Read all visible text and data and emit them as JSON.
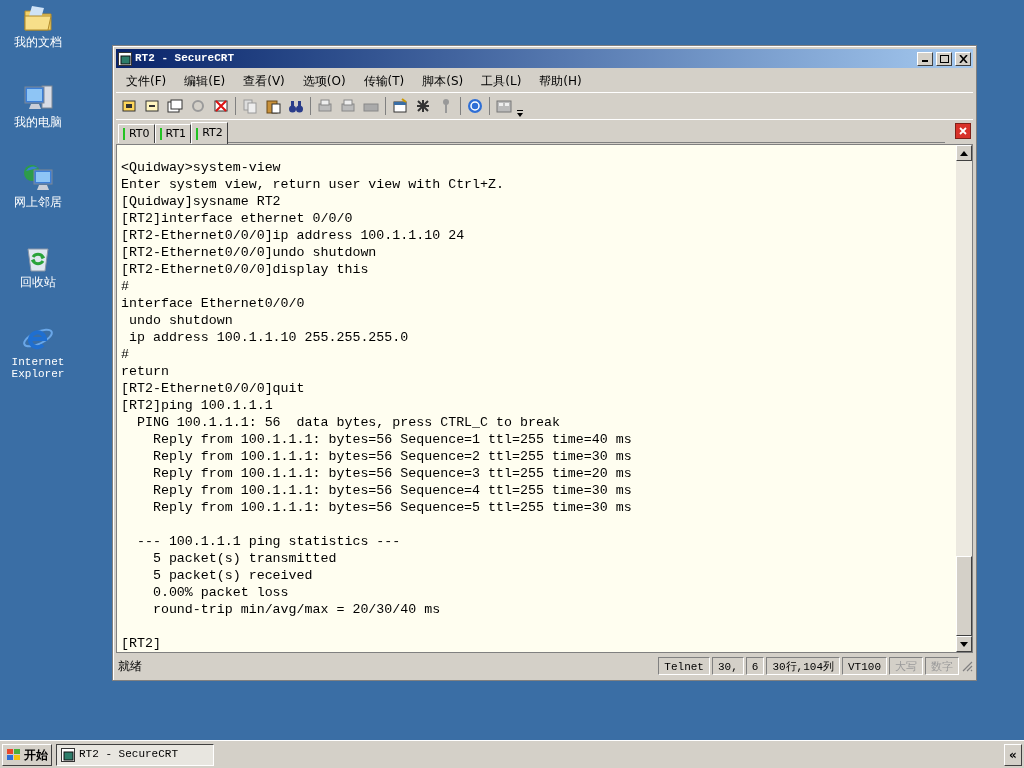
{
  "desktop_icons": [
    {
      "label": "我的文档",
      "kind": "folder"
    },
    {
      "label": "我的电脑",
      "kind": "computer"
    },
    {
      "label": "网上邻居",
      "kind": "network"
    },
    {
      "label": "回收站",
      "kind": "recycle"
    },
    {
      "label": "Internet Explorer",
      "kind": "browser"
    }
  ],
  "window": {
    "title": "RT2 - SecureCRT"
  },
  "menu": [
    "文件(F)",
    "编辑(E)",
    "查看(V)",
    "选项(O)",
    "传输(T)",
    "脚本(S)",
    "工具(L)",
    "帮助(H)"
  ],
  "tabs": [
    {
      "label": "RT0",
      "selected": false
    },
    {
      "label": "RT1",
      "selected": false
    },
    {
      "label": "RT2",
      "selected": true
    }
  ],
  "terminal": {
    "blocks": [
      [
        "<Quidway>system-view",
        "Enter system view, return user view with Ctrl+Z.",
        "[Quidway]sysname RT2",
        "[RT2]interface ethernet 0/0/0",
        "[RT2-Ethernet0/0/0]ip address 100.1.1.10 24",
        "[RT2-Ethernet0/0/0]undo shutdown",
        "[RT2-Ethernet0/0/0]display this",
        "#",
        "interface Ethernet0/0/0",
        " undo shutdown",
        " ip address 100.1.1.10 255.255.255.0",
        "#",
        "return",
        "[RT2-Ethernet0/0/0]quit",
        "[RT2]ping 100.1.1.1",
        "  PING 100.1.1.1: 56  data bytes, press CTRL_C to break",
        "    Reply from 100.1.1.1: bytes=56 Sequence=1 ttl=255 time=40 ms",
        "    Reply from 100.1.1.1: bytes=56 Sequence=2 ttl=255 time=30 ms",
        "    Reply from 100.1.1.1: bytes=56 Sequence=3 ttl=255 time=20 ms",
        "    Reply from 100.1.1.1: bytes=56 Sequence=4 ttl=255 time=30 ms",
        "    Reply from 100.1.1.1: bytes=56 Sequence=5 ttl=255 time=30 ms"
      ],
      [
        "  --- 100.1.1.1 ping statistics ---",
        "    5 packet(s) transmitted",
        "    5 packet(s) received",
        "    0.00% packet loss",
        "    round-trip min/avg/max = 20/30/40 ms"
      ],
      [
        "[RT2]"
      ]
    ]
  },
  "status_bar": {
    "message": "就绪",
    "panes": [
      {
        "text": "Telnet",
        "disabled": false
      },
      {
        "text": "30,",
        "disabled": false
      },
      {
        "text": "6",
        "disabled": false
      },
      {
        "text": "30行,104列",
        "disabled": false
      },
      {
        "text": "VT100",
        "disabled": false
      },
      {
        "text": "大写",
        "disabled": true
      },
      {
        "text": "数字",
        "disabled": true
      }
    ]
  },
  "taskbar": {
    "start": "开始",
    "tasks": [
      {
        "label": "RT2 - SecureCRT",
        "selected": true
      }
    ],
    "tray_button": "«"
  }
}
